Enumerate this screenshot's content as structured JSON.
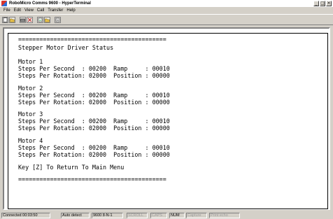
{
  "window": {
    "title": "RoboMicro Comms 9600 - HyperTerminal",
    "controls": [
      "_",
      "□",
      "×"
    ]
  },
  "menu": [
    "File",
    "Edit",
    "View",
    "Call",
    "Transfer",
    "Help"
  ],
  "toolbar": {
    "icons": [
      "new-connection-icon",
      "open-icon",
      "disconnect-icon",
      "phone-icon",
      "send-icon",
      "receive-icon",
      "properties-icon"
    ]
  },
  "terminal": {
    "lines": [
      "==========================================",
      "Stepper Motor Driver Status",
      "Motor 1",
      "Steps Per Second  : 00200  Ramp     : 00010",
      "Steps Per Rotation: 02000  Position : 00000",
      "Motor 2",
      "Steps Per Second  : 00200  Ramp     : 00010",
      "Steps Per Rotation: 02000  Position : 00000",
      "Motor 3",
      "Steps Per Second  : 00200  Ramp     : 00010",
      "Steps Per Rotation: 02000  Position : 00000",
      "Motor 4",
      "Steps Per Second  : 00200  Ramp     : 00010",
      "Steps Per Rotation: 02000  Position : 00000",
      "Key [Z] To Return To Main Menu",
      "=========================================="
    ]
  },
  "status": {
    "connected": "Connected 00:03:50",
    "detect": "Auto detect",
    "settings": "9600 8-N-1",
    "scroll": "SCROLL",
    "caps": "CAPS",
    "num": "NUM",
    "capture": "Capture",
    "print_echo": "Print echo"
  }
}
